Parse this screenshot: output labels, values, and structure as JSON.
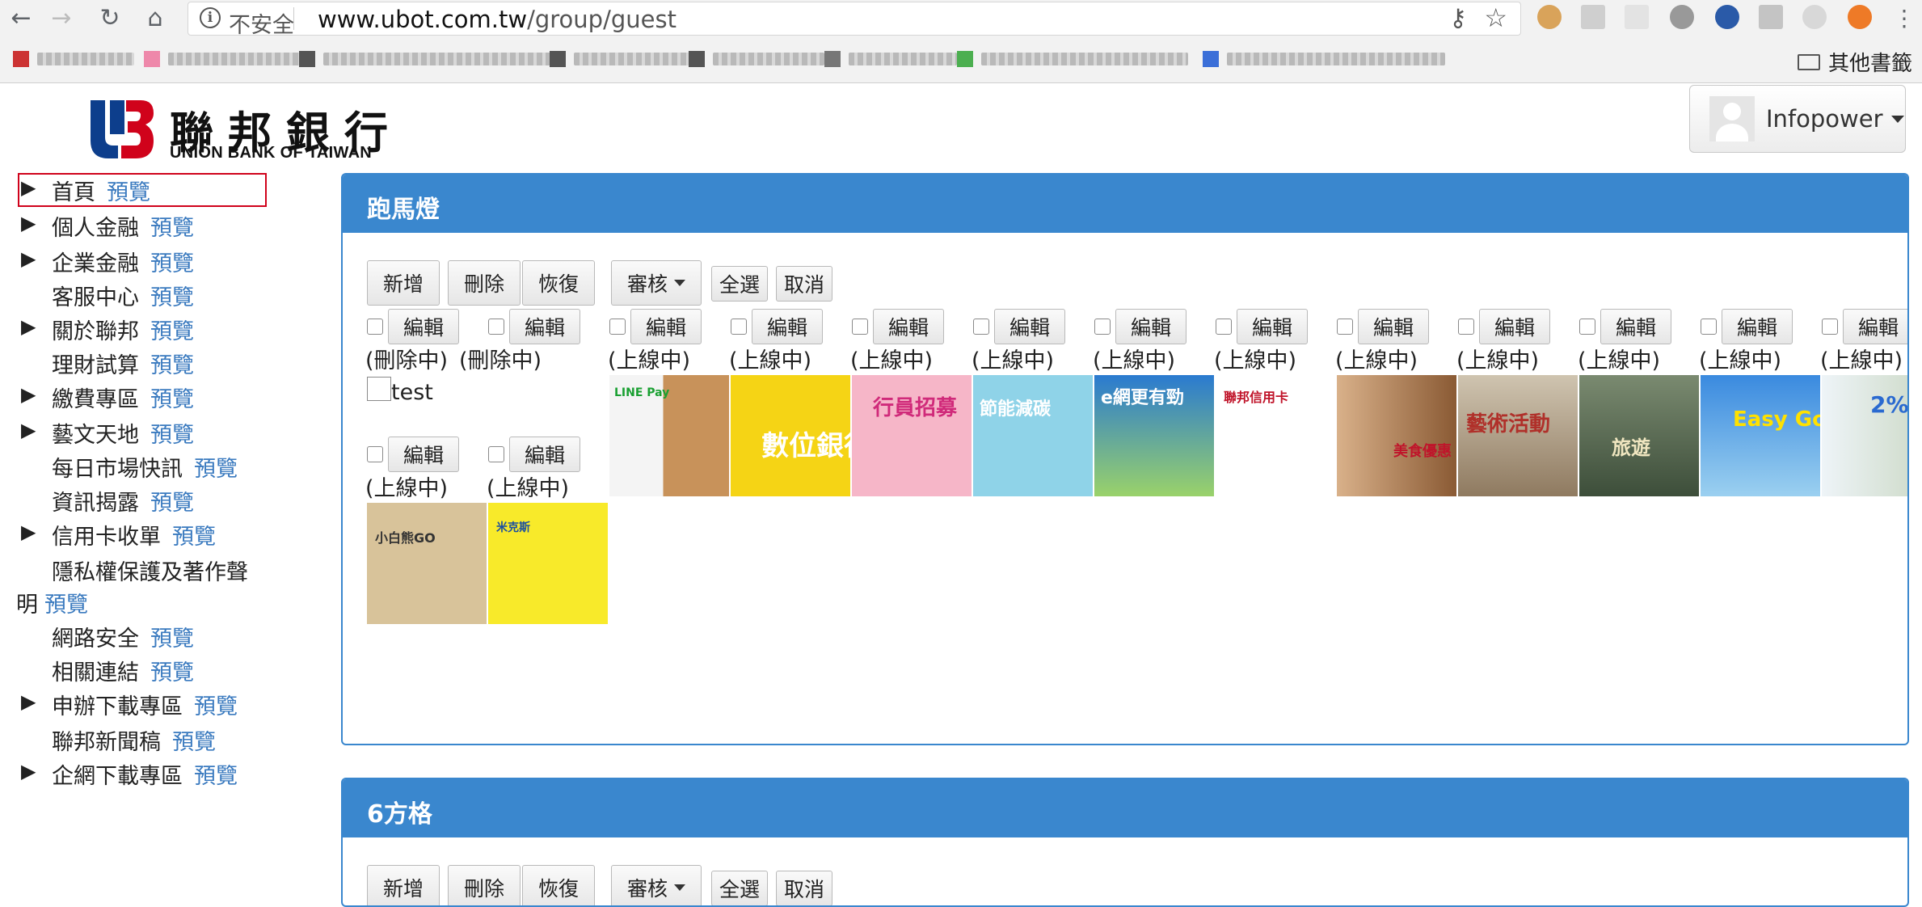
{
  "browser": {
    "security_label": "不安全",
    "url_host": "www.ubot.com.tw",
    "url_path": "/group/guest",
    "other_bookmarks": "其他書籤"
  },
  "header": {
    "logo_cn": "聯邦銀行",
    "logo_en": "UNION BANK OF TAIWAN",
    "user_name": "Infopower"
  },
  "sidebar": {
    "preview_label": "預覽",
    "items": [
      {
        "label": "首頁",
        "expandable": true
      },
      {
        "label": "個人金融",
        "expandable": true
      },
      {
        "label": "企業金融",
        "expandable": true
      },
      {
        "label": "客服中心",
        "expandable": false
      },
      {
        "label": "關於聯邦",
        "expandable": true
      },
      {
        "label": "理財試算",
        "expandable": false
      },
      {
        "label": "繳費專區",
        "expandable": true
      },
      {
        "label": "藝文天地",
        "expandable": true
      },
      {
        "label": "每日市場快訊",
        "expandable": false
      },
      {
        "label": "資訊揭露",
        "expandable": false
      },
      {
        "label": "信用卡收單",
        "expandable": true
      },
      {
        "label": "隱私權保護及著作聲",
        "label_cont": "明",
        "expandable": false
      },
      {
        "label": "網路安全",
        "expandable": false
      },
      {
        "label": "相關連結",
        "expandable": false
      },
      {
        "label": "申辦下載專區",
        "expandable": true
      },
      {
        "label": "聯邦新聞稿",
        "expandable": false
      },
      {
        "label": "企網下載專區",
        "expandable": true
      }
    ]
  },
  "marquee": {
    "title": "跑馬燈",
    "toolbar": {
      "add": "新增",
      "delete": "刪除",
      "restore": "恢復",
      "review": "審核",
      "select_all": "全選",
      "cancel": "取消"
    },
    "edit_label": "編輯",
    "items": [
      {
        "status": "(刪除中)",
        "caption": "test"
      },
      {
        "status": "(刪除中)"
      },
      {
        "status": "(上線中)",
        "banner": "LINE Pay"
      },
      {
        "status": "(上線中)",
        "banner": "數位銀行"
      },
      {
        "status": "(上線中)",
        "banner": "行員招募"
      },
      {
        "status": "(上線中)",
        "banner": "節能減碳"
      },
      {
        "status": "(上線中)",
        "banner": "e網更有勁"
      },
      {
        "status": "(上線中)",
        "banner": "聯邦信用卡"
      },
      {
        "status": "(上線中)",
        "banner": "美食優惠"
      },
      {
        "status": "(上線中)",
        "banner": "藝術活動"
      },
      {
        "status": "(上線中)",
        "banner": "旅遊"
      },
      {
        "status": "(上線中)",
        "banner": "Easy Go"
      },
      {
        "status": "(上線中)",
        "banner": "2%"
      },
      {
        "status": "(上線中)",
        "banner": "小白熊GO"
      },
      {
        "status": "(上線中)",
        "banner": "米克斯"
      }
    ]
  },
  "grid6": {
    "title": "6方格"
  },
  "colors": {
    "panel_blue": "#3a87ce",
    "link_blue": "#3a7abf",
    "highlight_red": "#d0021b"
  }
}
